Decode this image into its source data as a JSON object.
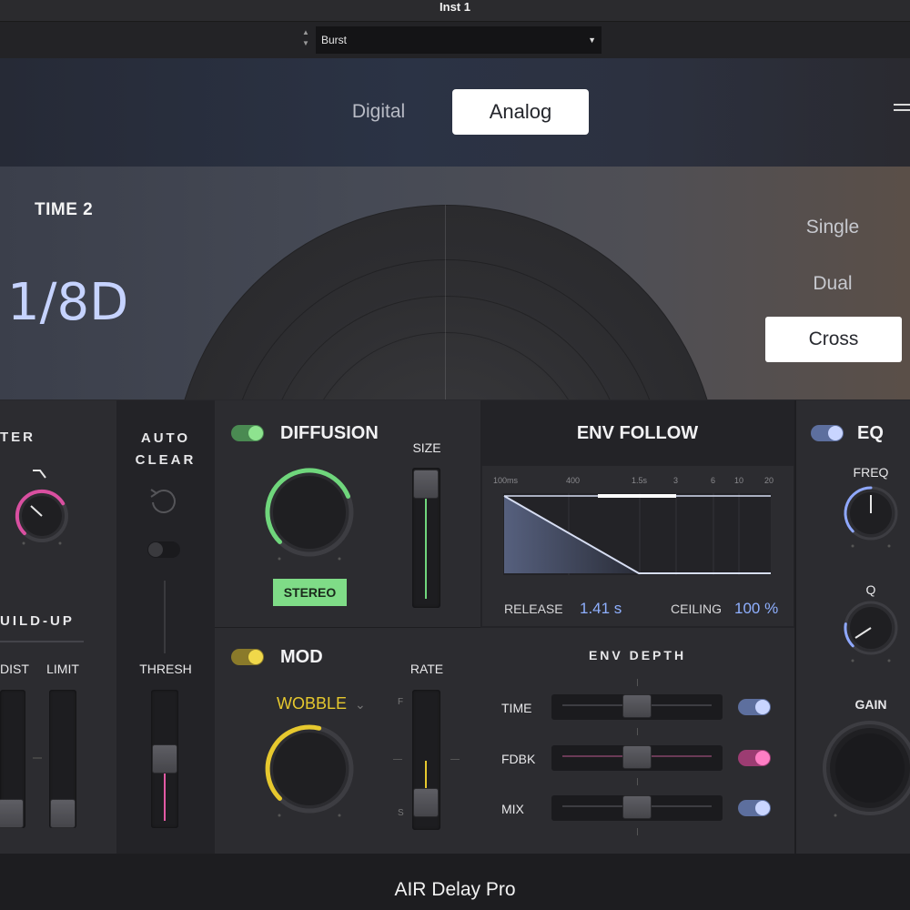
{
  "window": {
    "title": "Inst 1",
    "footer_title": "AIR Delay Pro"
  },
  "preset": {
    "name": "Burst",
    "stepper_up": "▲",
    "stepper_down": "▼",
    "caret": "▼"
  },
  "mode": {
    "digital": "Digital",
    "analog": "Analog",
    "selected": "Analog"
  },
  "time": {
    "label": "TIME 2",
    "value": "1/8D",
    "tap_modes": [
      "Single",
      "Dual",
      "Cross"
    ],
    "tap_selected": "Cross"
  },
  "filter": {
    "title": "TER",
    "knob_value": 0.72,
    "accent": "#d94fa0"
  },
  "buildup": {
    "title": "UILD-UP",
    "dist_label": "DIST",
    "limit_label": "LIMIT",
    "dist_value": 0.1,
    "limit_value": 0.1
  },
  "autoclear": {
    "title_line1": "AUTO",
    "title_line2": "CLEAR",
    "enabled": false,
    "thresh_label": "THRESH",
    "thresh_value": 0.6,
    "accent": "#e35aa4"
  },
  "diffusion": {
    "title": "DIFFUSION",
    "enabled": true,
    "stereo_label": "STEREO",
    "size_label": "SIZE",
    "knob_value": 0.75,
    "size_value": 0.95,
    "accent": "#6fd67c"
  },
  "mod": {
    "title": "MOD",
    "enabled": true,
    "shape": "WOBBLE",
    "rate_label": "RATE",
    "rate_top": "F",
    "rate_bottom": "S",
    "knob_value": 0.55,
    "rate_value": 0.4,
    "accent": "#e6c82e"
  },
  "env_follow": {
    "title": "ENV FOLLOW",
    "scale": [
      "100ms",
      "400",
      "1.5s",
      "3",
      "6",
      "10",
      "20"
    ],
    "release_label": "RELEASE",
    "release_value": "1.41 s",
    "ceiling_label": "CEILING",
    "ceiling_value": "100 %",
    "value_color": "#8fb0ff"
  },
  "env_depth": {
    "title": "ENV DEPTH",
    "rows": [
      {
        "label": "TIME",
        "value": 0.5,
        "toggle_color": "#8fa8ff"
      },
      {
        "label": "FDBK",
        "value": 0.5,
        "toggle_color": "#e35aa4"
      },
      {
        "label": "MIX",
        "value": 0.5,
        "toggle_color": "#8fa8ff"
      }
    ]
  },
  "eq": {
    "title": "EQ",
    "enabled": true,
    "freq_label": "FREQ",
    "q_label": "Q",
    "gain_label": "GAIN",
    "freq_value": 0.5,
    "q_value": 0.2,
    "gain_value": 0.5,
    "accent": "#8fa8ff"
  }
}
